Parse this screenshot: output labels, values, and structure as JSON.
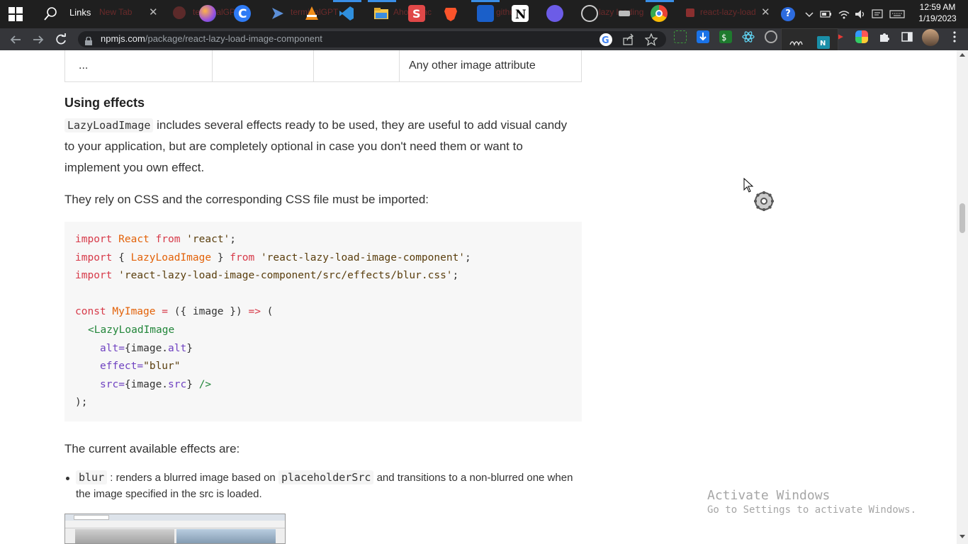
{
  "taskbar": {
    "links_label": "Links",
    "ghost_tabs": [
      "New Tab",
      "terminalGPT",
      "terminalGPT",
      "Ahoraajac",
      "github",
      "lazy loading",
      "react-lazy-load"
    ],
    "clock_time": "12:59 AM",
    "clock_date": "1/19/2023",
    "icons": [
      "windows-start-icon",
      "search-icon",
      "firefox-icon",
      "cursor-c-icon",
      "powershell-icon",
      "vlc-icon",
      "vscode-icon",
      "file-explorer-icon",
      "s-app-icon",
      "brave-icon",
      "app-icon",
      "notion-icon",
      "proton-icon",
      "openai-icon",
      "github-icon",
      "chrome-icon"
    ],
    "tray_icons": [
      "help-icon",
      "chevron-up-icon",
      "battery-icon",
      "wifi-icon",
      "volume-icon",
      "notification-icon",
      "keyboard-icon"
    ]
  },
  "browser": {
    "url_host": "npmjs.com",
    "url_path": "/package/react-lazy-load-image-component",
    "nav_icons": [
      "back-icon",
      "forward-icon",
      "reload-icon"
    ],
    "omni_icons": [
      "google-icon",
      "share-icon",
      "star-icon"
    ]
  },
  "table": {
    "cells": [
      "...",
      "",
      "",
      "Any other image attribute"
    ]
  },
  "section": {
    "heading": "Using effects",
    "para1_code": "LazyLoadImage",
    "para1_rest_line1": " includes several effects ready to be used, they are useful to add visual candy",
    "para1_line2": "to your application, but are completely optional in case you don't need them or want to",
    "para1_line3": "implement you own effect.",
    "para2": "They rely on CSS and the corresponding CSS file must be imported:",
    "code": {
      "l1_kw": "import",
      "l1_id": "React",
      "l1_from": "from",
      "l1_str": "'react'",
      "l2_kw": "import",
      "l2_brace_open": "{ ",
      "l2_id": "LazyLoadImage",
      "l2_brace_close": " }",
      "l2_from": "from",
      "l2_str": "'react-lazy-load-image-component'",
      "l3_kw": "import",
      "l3_str": "'react-lazy-load-image-component/src/effects/blur.css'",
      "l5_kw": "const",
      "l5_id": "MyImage",
      "l5_eq": "=",
      "l5_args": "({ image })",
      "l5_arrow": "=>",
      "l5_paren": "(",
      "l6_tag": "<LazyLoadImage",
      "l7_attr": "alt=",
      "l7_val": "{image.",
      "l7_prop": "alt",
      "l7_close": "}",
      "l8_attr": "effect=",
      "l8_val": "\"blur\"",
      "l9_attr": "src=",
      "l9_val": "{image.",
      "l9_prop": "src",
      "l9_close": "}",
      "l9_tag_end": "/>",
      "l10": ");",
      "semicolon": ";"
    },
    "para3": "The current available effects are:",
    "list_item_code1": "blur",
    "list_item_text1": ": renders a blurred image based on",
    "list_item_code2": "placeholderSrc",
    "list_item_text2": "and transitions to a non-blurred one when",
    "list_item_line2": "the image specified in the src is loaded."
  },
  "watermark": {
    "line1": "Activate Windows",
    "line2": "Go to Settings to activate Windows."
  },
  "colors": {
    "taskbar_bg": "#1f1f1f",
    "toolbar_bg": "#35363a",
    "code_bg": "#f7f7f7",
    "keyword": "#d73a49",
    "identifier": "#e36209",
    "tag": "#22863a"
  }
}
